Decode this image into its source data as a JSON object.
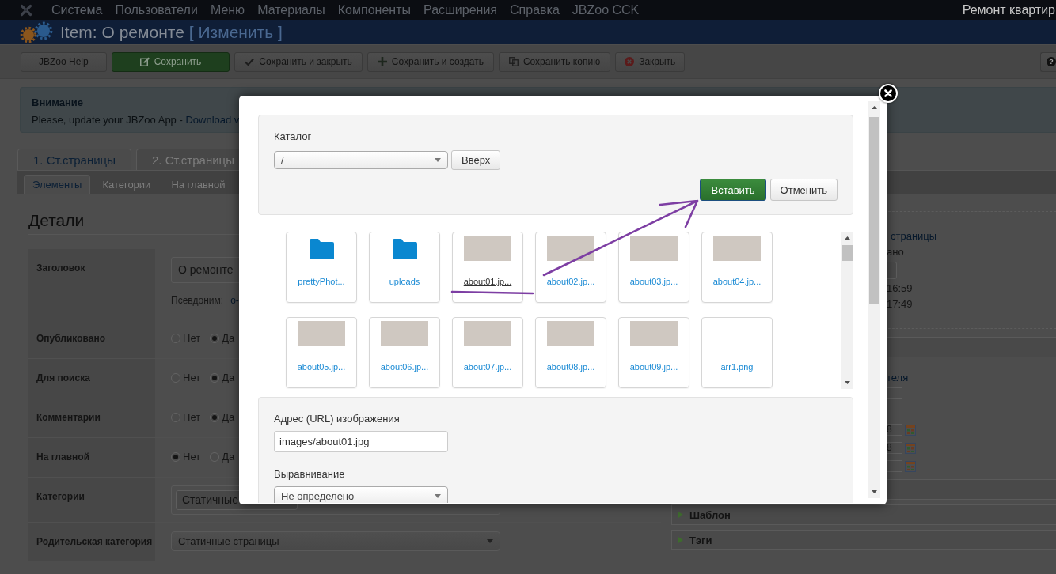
{
  "navbar": {
    "menu": [
      "Система",
      "Пользователи",
      "Меню",
      "Материалы",
      "Компоненты",
      "Расширения",
      "Справка",
      "JBZoo CCK"
    ],
    "site_name": "Ремонт квартир"
  },
  "header": {
    "title": "Item: О ремонте",
    "action": "[ Изменить ]"
  },
  "toolbar": {
    "buttons": [
      {
        "kind": "plain",
        "label": "JBZoo Help"
      },
      {
        "kind": "save",
        "label": "Сохранить"
      },
      {
        "kind": "check",
        "label": "Сохранить и закрыть"
      },
      {
        "kind": "plus",
        "label": "Сохранить и создать"
      },
      {
        "kind": "copy",
        "label": "Сохранить копию"
      },
      {
        "kind": "close",
        "label": "Закрыть"
      }
    ],
    "help": "?"
  },
  "alert": {
    "title": "Внимание",
    "text": "Please, update your JBZoo App -",
    "link": "Download v"
  },
  "tabs": [
    {
      "label": "1. Ст.страницы",
      "selected": true
    },
    {
      "label": "2. Ст.страницы",
      "selected": false
    }
  ],
  "subtabs": [
    {
      "label": "Элементы",
      "selected": true
    },
    {
      "label": "Категории",
      "selected": false
    },
    {
      "label": "На главной",
      "selected": false
    }
  ],
  "details": {
    "heading": "Детали",
    "fields": [
      {
        "kind": "text",
        "label": "Заголовок",
        "value": "О ремонте",
        "alias_label": "Псевдоним:",
        "alias": "o-"
      },
      {
        "kind": "radio",
        "label": "Опубликовано",
        "options": [
          {
            "label": "Нет",
            "selected": false
          },
          {
            "label": "Да",
            "selected": true
          }
        ]
      },
      {
        "kind": "radio",
        "label": "Для поиска",
        "options": [
          {
            "label": "Нет",
            "selected": false
          },
          {
            "label": "Да",
            "selected": true
          }
        ]
      },
      {
        "kind": "radio",
        "label": "Комментарии",
        "options": [
          {
            "label": "Нет",
            "selected": false
          },
          {
            "label": "Да",
            "selected": true
          }
        ]
      },
      {
        "kind": "radio",
        "label": "На главной",
        "options": [
          {
            "label": "Нет",
            "selected": true
          },
          {
            "label": "Да",
            "selected": false
          }
        ]
      },
      {
        "kind": "tags",
        "label": "Категории",
        "tags": [
          "Статичные"
        ]
      },
      {
        "kind": "select",
        "label": "Родительская категория",
        "value": "Статичные страницы"
      }
    ]
  },
  "side_panel": {
    "info": [
      {
        "kind": "link",
        "text": "страницы"
      },
      {
        "kind": "text",
        "text": "ано"
      },
      {
        "kind": "button"
      },
      {
        "kind": "text",
        "text": "16:59"
      },
      {
        "kind": "text",
        "text": "17:49"
      }
    ],
    "fields": [
      {
        "kind": "input"
      },
      {
        "kind": "link",
        "text": "теля"
      },
      {
        "kind": "input"
      },
      {
        "kind": "date",
        "value": "8"
      },
      {
        "kind": "date",
        "value": "8"
      },
      {
        "kind": "date"
      }
    ],
    "accordions": [
      {
        "title": "Шаблон",
        "expanded": false
      },
      {
        "title": "Тэги",
        "expanded": false
      }
    ]
  },
  "modal": {
    "catalog": {
      "label": "Каталог",
      "value": "/"
    },
    "up_button": "Вверх",
    "insert_button": "Вставить",
    "cancel_button": "Отменить",
    "files": [
      {
        "kind": "folder",
        "name": "prettyPhot...",
        "selected": false
      },
      {
        "kind": "folder",
        "name": "uploads",
        "selected": false
      },
      {
        "kind": "image",
        "name": "about01.jp...",
        "selected": true
      },
      {
        "kind": "image",
        "name": "about02.jp...",
        "selected": false
      },
      {
        "kind": "image",
        "name": "about03.jp...",
        "selected": false
      },
      {
        "kind": "image",
        "name": "about04.jp...",
        "selected": false
      },
      {
        "kind": "image",
        "name": "about05.jp...",
        "selected": false
      },
      {
        "kind": "image",
        "name": "about06.jp...",
        "selected": false
      },
      {
        "kind": "image",
        "name": "about07.jp...",
        "selected": false
      },
      {
        "kind": "image",
        "name": "about08.jp...",
        "selected": false
      },
      {
        "kind": "image",
        "name": "about09.jp...",
        "selected": false
      },
      {
        "kind": "file",
        "name": "arr1.png",
        "selected": false
      }
    ],
    "url": {
      "label": "Адрес (URL) изображения",
      "value": "images/about01.jpg"
    },
    "align": {
      "label": "Выравнивание",
      "value": "Не определено"
    }
  }
}
